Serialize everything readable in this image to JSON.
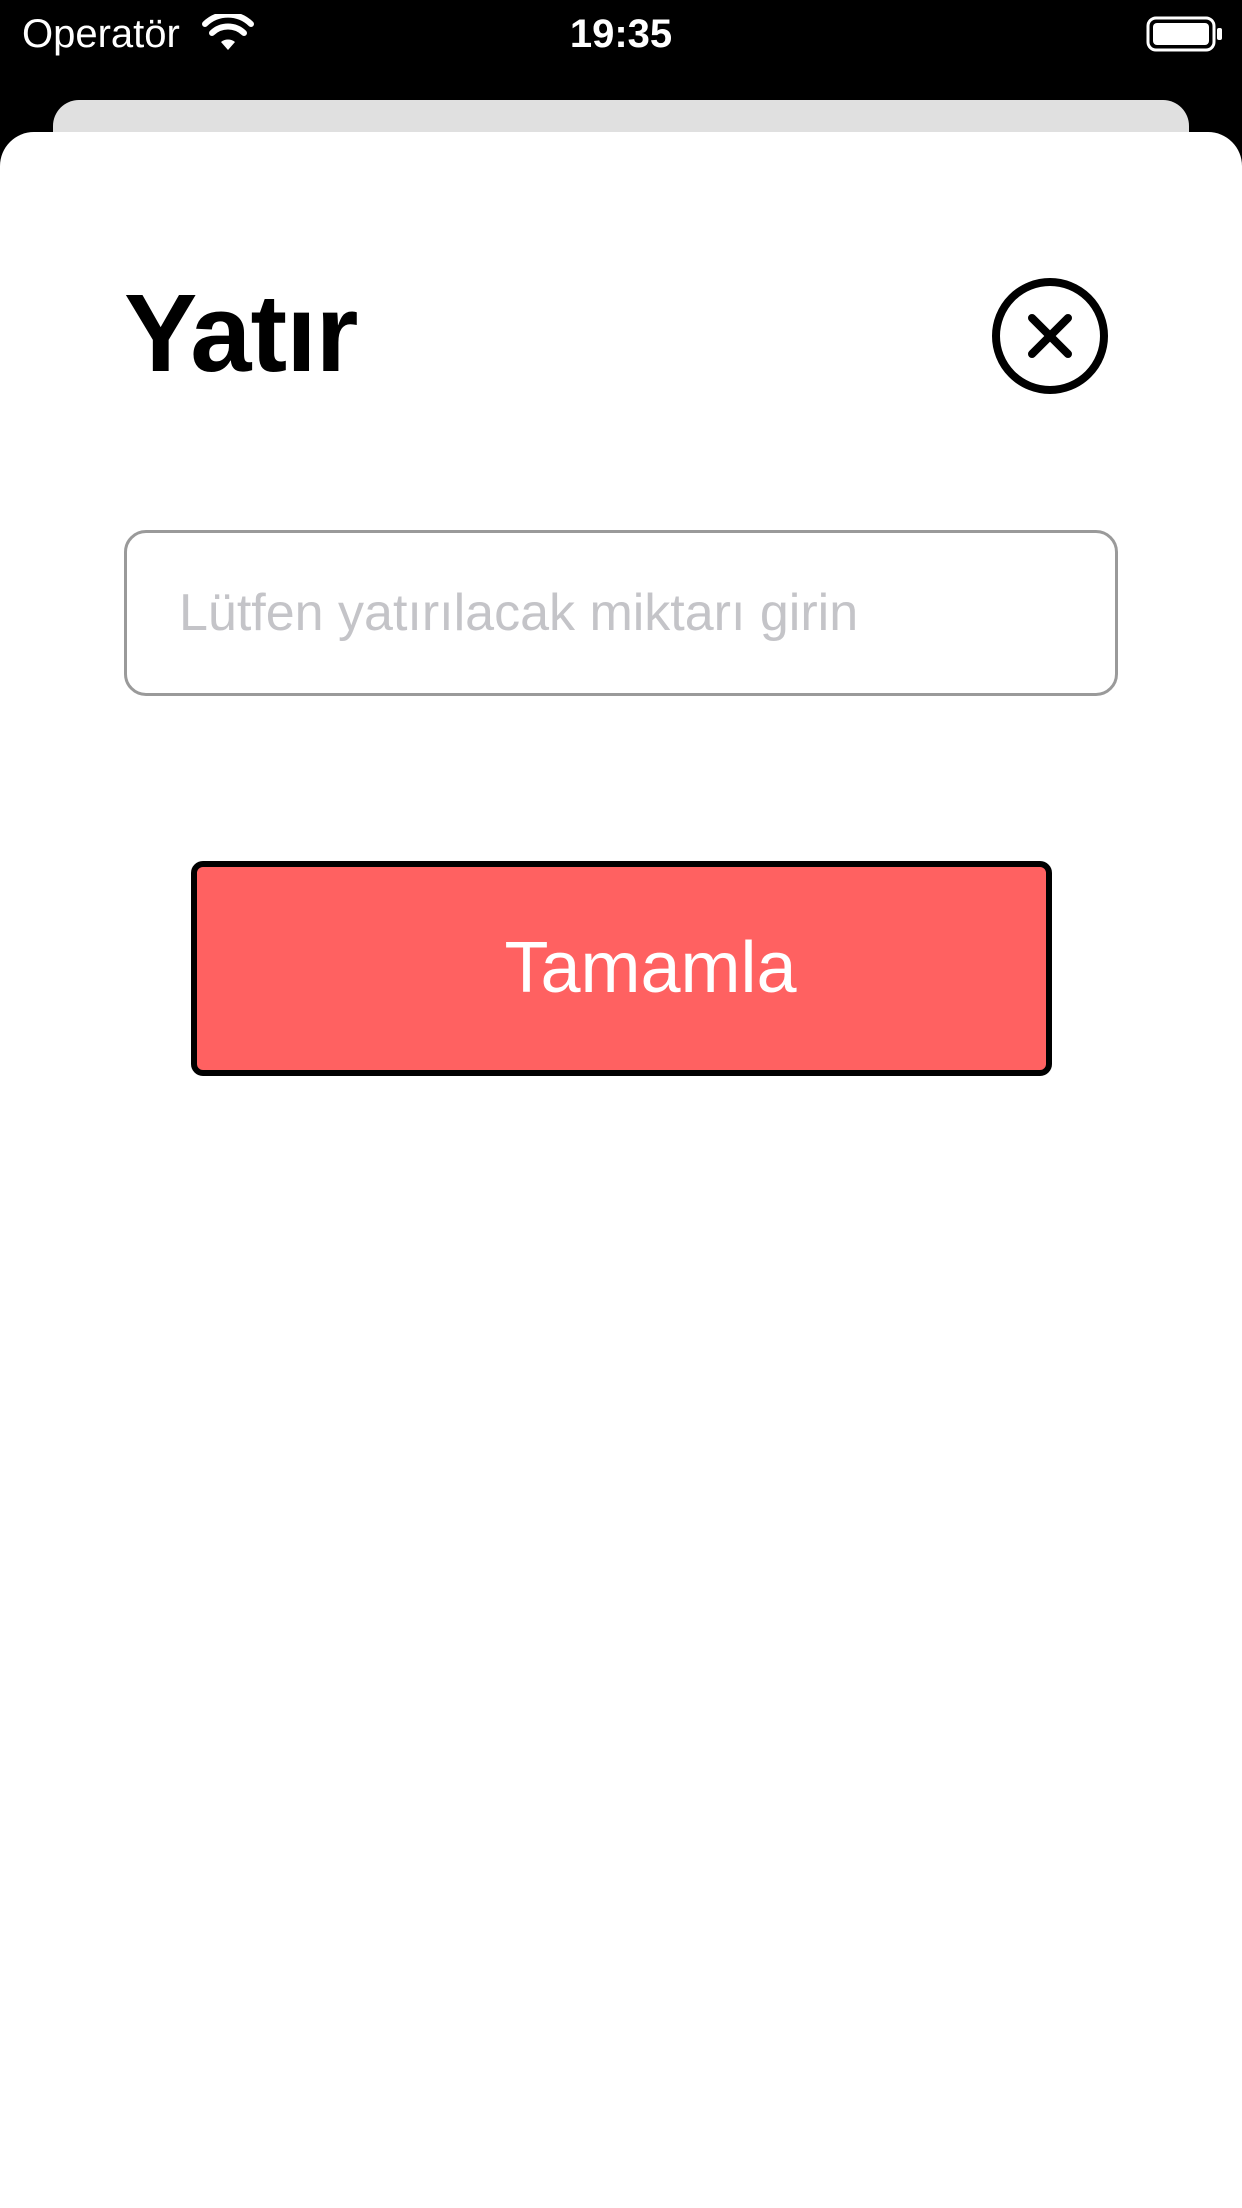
{
  "status_bar": {
    "carrier": "Operatör",
    "time": "19:35",
    "wifi_icon": "wifi-icon",
    "battery_icon": "battery-full-icon"
  },
  "sheet": {
    "title": "Yatır",
    "close_icon": "close-circle-icon",
    "amount_input": {
      "value": "",
      "placeholder": "Lütfen yatırılacak miktarı girin"
    },
    "complete_button": {
      "label": "Tamamla"
    }
  },
  "colors": {
    "sheet_background": "#ffffff",
    "back_card": "#e0e0e0",
    "button_fill": "#ff6161",
    "button_border": "#000000",
    "input_border": "#9a9a9a",
    "placeholder": "#c4c4c8"
  }
}
